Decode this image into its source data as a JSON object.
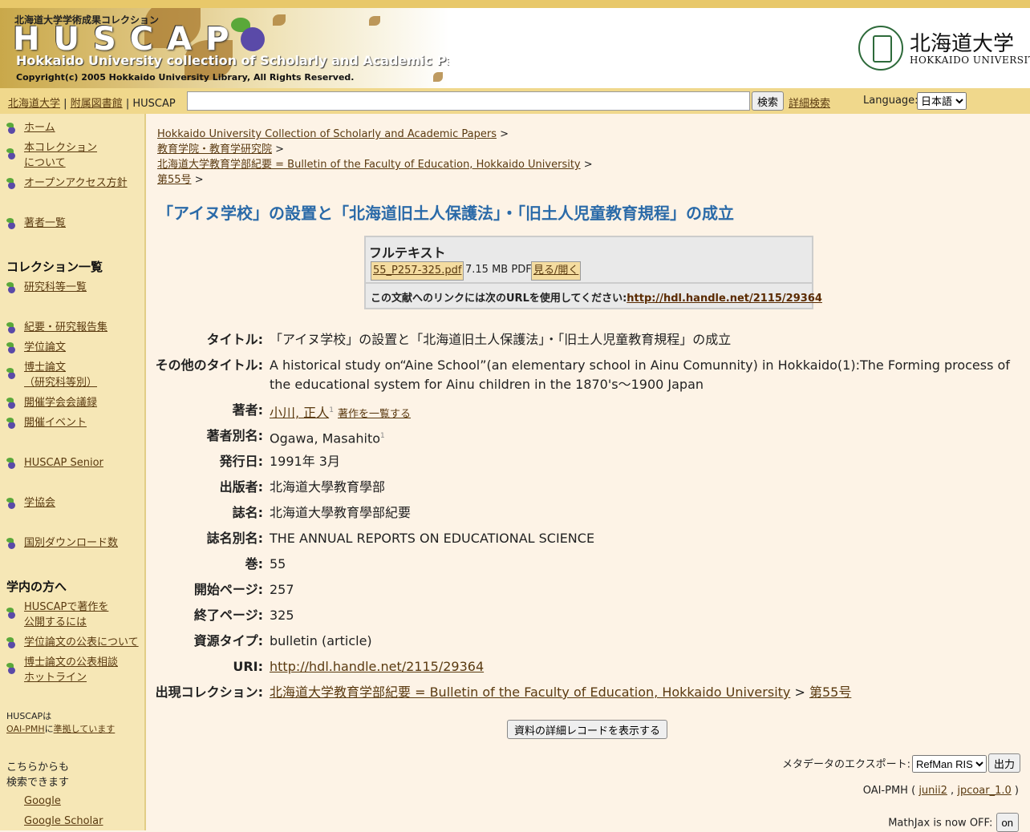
{
  "header": {
    "banner_jp": "北海道大学学術成果コレクション",
    "banner_logo": "HUSCAP",
    "banner_sub": "Hokkaido University collection of Scholarly and Academic Papers",
    "banner_copy": "Copyright(c) 2005 Hokkaido University Library, All Rights Reserved.",
    "univ_name": "北海道大学",
    "univ_en": "HOKKAIDO UNIVERSITY"
  },
  "navbar": {
    "link_univ": "北海道大学",
    "sep": "|",
    "link_library": "附属図書館",
    "link_huscap": "HUSCAP",
    "search_value": "",
    "search_button": "検索",
    "advanced_search": "詳細検索",
    "language_label": "Language:",
    "language_selected": "日本語"
  },
  "sidebar": {
    "home": "ホーム",
    "about": "本コレクション\nについて",
    "oa_policy": "オープンアクセス方針",
    "authors": "著者一覧",
    "collections_heading": "コレクション一覧",
    "departments": "研究科等一覧",
    "bulletins": "紀要・研究報告集",
    "theses": "学位論文",
    "doctoral": "博士論文\n（研究科等別）",
    "conference": "開催学会会議録",
    "events": "開催イベント",
    "senior": "HUSCAP Senior",
    "societies": "学協会",
    "downloads": "国別ダウンロード数",
    "campus_heading": "学内の方へ",
    "publish": "HUSCAPで著作を\n公開するには",
    "thesis_publish": "学位論文の公表について",
    "doctoral_hotline": "博士論文の公表相談\nホットライン",
    "oai_note_1": "HUSCAPは",
    "oai_note_link": "OAI-PMH",
    "oai_note_2": "に",
    "oai_note_link2": "準拠しています",
    "search_here_1": "こちらからも",
    "search_here_2": "検索できます",
    "google": "Google",
    "google_scholar": "Google Scholar"
  },
  "breadcrumbs": [
    "Hokkaido University Collection of Scholarly and Academic Papers",
    "教育学院・教育学研究院",
    "北海道大学教育学部紀要 = Bulletin of the Faculty of Education, Hokkaido University",
    "第55号"
  ],
  "crumb_sep": ">",
  "title": "「アイヌ学校」の設置と「北海道旧土人保護法」・「旧土人児童教育規程」の成立",
  "fulltext": {
    "heading": "フルテキスト",
    "file_name": "55_P257-325.pdf",
    "file_size": "7.15 MB",
    "file_type": "PDF",
    "open_label": "見る/開く",
    "link_text": "この文献へのリンクには次のURLを使用してください:",
    "link_url": "http://hdl.handle.net/2115/29364"
  },
  "metadata": {
    "title_label": "タイトル:",
    "title_value": "「アイヌ学校」の設置と「北海道旧土人保護法」・「旧土人児童教育規程」の成立",
    "alt_title_label": "その他のタイトル:",
    "alt_title_value": "A historical study on“Aine School”(an elementary school in Ainu Comunnity) in Hokkaido(1):The Forming process of the educational system for Ainu children in the 1870's〜1900 Japan",
    "author_label": "著者:",
    "author_value": "小川, 正人",
    "author_sup": "1",
    "author_list": "著作を一覧する",
    "author_alt_label": "著者別名:",
    "author_alt_value": "Ogawa, Masahito",
    "author_alt_sup": "1",
    "date_label": "発行日:",
    "date_value": "1991年 3月",
    "publisher_label": "出版者:",
    "publisher_value": "北海道大學教育學部",
    "journal_label": "誌名:",
    "journal_value": "北海道大學教育學部紀要",
    "journal_alt_label": "誌名別名:",
    "journal_alt_value": "THE ANNUAL REPORTS ON EDUCATIONAL SCIENCE",
    "volume_label": "巻:",
    "volume_value": "55",
    "start_page_label": "開始ページ:",
    "start_page_value": "257",
    "end_page_label": "終了ページ:",
    "end_page_value": "325",
    "type_label": "資源タイプ:",
    "type_value": "bulletin (article)",
    "uri_label": "URI:",
    "uri_value": "http://hdl.handle.net/2115/29364",
    "collection_label": "出現コレクション:",
    "collection_value": "北海道大学教育学部紀要 = Bulletin of the Faculty of Education, Hokkaido University",
    "collection_sep": ">",
    "collection_issue": "第55号"
  },
  "actions": {
    "detail_button": "資料の詳細レコードを表示する",
    "export_label": "メタデータのエクスポート:",
    "export_selected": "RefMan RIS",
    "export_button": "出力",
    "oai_prefix": "OAI-PMH (",
    "oai_junii2": "junii2",
    "oai_comma": ",",
    "oai_jpcoar": "jpcoar_1.0",
    "oai_suffix": ")",
    "mathjax_label": "MathJax is now OFF:",
    "mathjax_button": "on"
  }
}
